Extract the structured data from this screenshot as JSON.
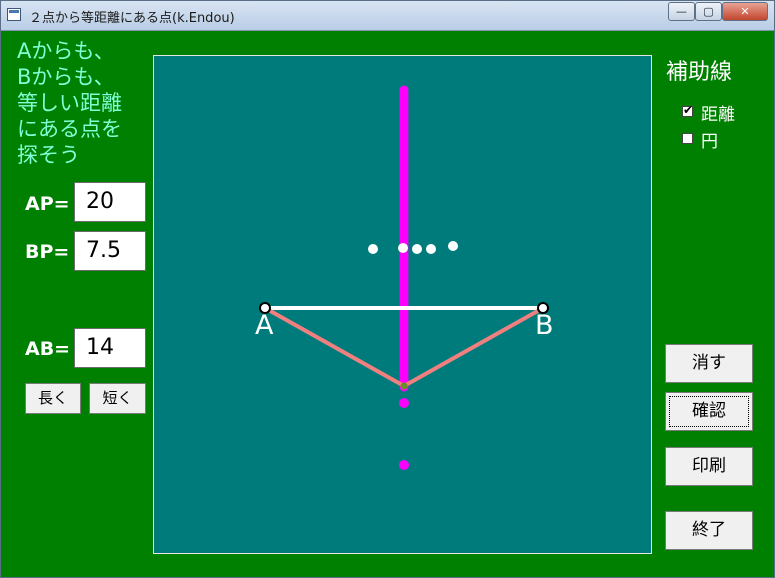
{
  "window": {
    "title": "２点から等距離にある点(k.Endou)",
    "minimize_glyph": "—",
    "maximize_glyph": "▢",
    "close_glyph": "✕"
  },
  "question": {
    "lines": [
      "Aからも、",
      "Bからも、",
      "等しい距離",
      "にある点を",
      "探そう"
    ]
  },
  "fields": {
    "ap": {
      "label": "AP=",
      "value": "20"
    },
    "bp": {
      "label": "BP=",
      "value": "7.5"
    },
    "ab": {
      "label": "AB=",
      "value": "14"
    }
  },
  "buttons": {
    "longer": "長く",
    "shorter": "短く",
    "clear": "消す",
    "check": "確認",
    "print": "印刷",
    "exit": "終了"
  },
  "aux": {
    "title": "補助線",
    "distance": {
      "label": "距離",
      "checked": true,
      "tick": "✔"
    },
    "circle": {
      "label": "円",
      "checked": false
    }
  },
  "figure": {
    "point_a": "A",
    "point_b": "B",
    "colors": {
      "canvas": "#007b7b",
      "segment": "#ffffff",
      "bisector": "#ff00ff",
      "distance_lines": "#f08080",
      "endpoints": "#000000",
      "stray_points": "#ffffff"
    }
  }
}
